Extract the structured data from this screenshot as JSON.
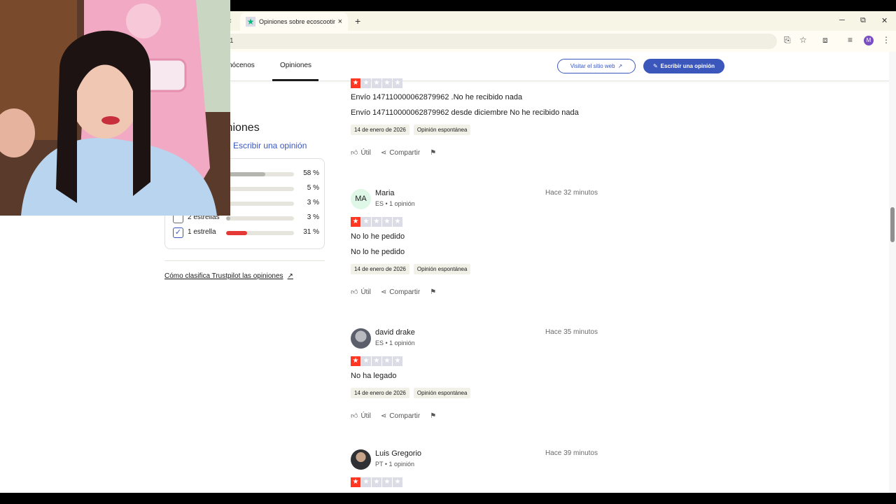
{
  "browser": {
    "tab_title": "Opiniones sobre ecoscooting.c",
    "tab_close": "×",
    "new_tab": "+",
    "url_fragment": "1",
    "profile_initial": "M",
    "window_min": "─",
    "window_max": "⧉",
    "window_close": "✕"
  },
  "subnav": {
    "conocenos": "nócenos",
    "opiniones": "Opiniones",
    "visit_label": "Visitar el sitio web",
    "write_label": "Escribir una opinión"
  },
  "sidebar": {
    "heading": "iniones",
    "write_link": "Escribir una opinión",
    "ratings": [
      {
        "label": "",
        "pct": "58 %",
        "value": 0.58,
        "checked": false
      },
      {
        "label": "",
        "pct": "5 %",
        "value": 0.05,
        "checked": false
      },
      {
        "label": "",
        "pct": "3 %",
        "value": 0.03,
        "checked": false
      },
      {
        "label": "2 estrellas",
        "pct": "3 %",
        "value": 0.03,
        "checked": false
      },
      {
        "label": "1 estrella",
        "pct": "31 %",
        "value": 0.31,
        "checked": true
      }
    ],
    "how_link": "Cómo clasifica Trustpilot las opiniones"
  },
  "reviews": [
    {
      "title": "Envío 147110000062879962 .No he recibido nada",
      "body": "Envío 147110000062879962 desde diciembre No he recibido nada",
      "date": "14 de enero de 2026",
      "tag": "Opinión espontánea",
      "rating": 1
    },
    {
      "initials": "MA",
      "name": "Maria",
      "meta": "ES • 1 opinión",
      "time": "Hace 32 minutos",
      "title": "No lo he pedido",
      "body": "No lo he pedido",
      "date": "14 de enero de 2026",
      "tag": "Opinión espontánea",
      "rating": 1
    },
    {
      "name": "david drake",
      "meta": "ES • 1 opinión",
      "time": "Hace 35 minutos",
      "title": "No ha legado",
      "date": "14 de enero de 2026",
      "tag": "Opinión espontánea",
      "rating": 1
    },
    {
      "name": "Luis Gregorio",
      "meta": "PT • 1 opinión",
      "time": "Hace 39 minutos",
      "rating": 1
    }
  ],
  "actions": {
    "useful": "Útil",
    "share": "Compartir"
  },
  "icons": {
    "trustpilot_star": "star-icon",
    "thumb": "thumb-up-icon",
    "share": "share-icon",
    "flag": "flag-icon",
    "external": "external-link-icon",
    "pencil": "pencil-icon"
  },
  "colors": {
    "accent": "#3c57bc",
    "star_red": "#ff3722",
    "bar_red": "#e53935",
    "trustpilot_green": "#00b67a"
  }
}
